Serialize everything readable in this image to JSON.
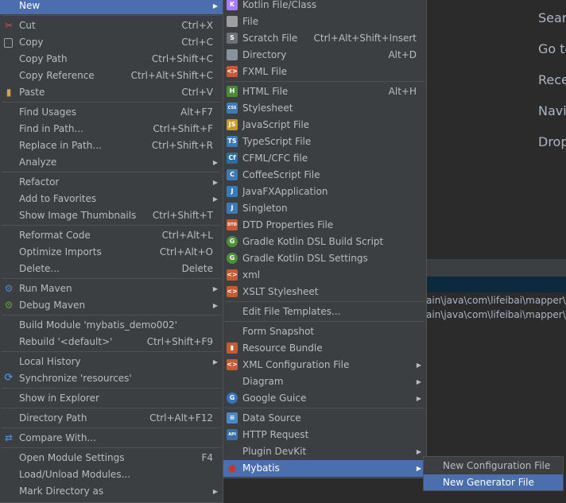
{
  "editor_hints": [
    "Searc",
    "Go to",
    "Rece",
    "Navi",
    "Drop"
  ],
  "console_lines": [
    "ain\\java\\com\\lifeibai\\mapper\\U",
    "ain\\java\\com\\lifeibai\\mapper\\C"
  ],
  "main_menu": [
    {
      "label": "New",
      "shortcut": "",
      "arrow": true,
      "sel": true,
      "icon": ""
    },
    {
      "label": "Cut",
      "shortcut": "Ctrl+X",
      "icon": "scissors-icon"
    },
    {
      "label": "Copy",
      "shortcut": "Ctrl+C",
      "icon": "copy-icon"
    },
    {
      "label": "Copy Path",
      "shortcut": "Ctrl+Shift+C"
    },
    {
      "label": "Copy Reference",
      "shortcut": "Ctrl+Alt+Shift+C"
    },
    {
      "label": "Paste",
      "shortcut": "Ctrl+V",
      "icon": "paste-icon"
    },
    {
      "label": "Find Usages",
      "shortcut": "Alt+F7"
    },
    {
      "label": "Find in Path...",
      "shortcut": "Ctrl+Shift+F"
    },
    {
      "label": "Replace in Path...",
      "shortcut": "Ctrl+Shift+R"
    },
    {
      "label": "Analyze",
      "shortcut": "",
      "arrow": true
    },
    {
      "label": "Refactor",
      "shortcut": "",
      "arrow": true
    },
    {
      "label": "Add to Favorites",
      "shortcut": "",
      "arrow": true
    },
    {
      "label": "Show Image Thumbnails",
      "shortcut": "Ctrl+Shift+T"
    },
    {
      "label": "Reformat Code",
      "shortcut": "Ctrl+Alt+L"
    },
    {
      "label": "Optimize Imports",
      "shortcut": "Ctrl+Alt+O"
    },
    {
      "label": "Delete...",
      "shortcut": "Delete"
    },
    {
      "label": "Run Maven",
      "shortcut": "",
      "arrow": true,
      "icon": "maven-run-icon"
    },
    {
      "label": "Debug Maven",
      "shortcut": "",
      "arrow": true,
      "icon": "maven-debug-icon"
    },
    {
      "label": "Build Module 'mybatis_demo002'",
      "shortcut": ""
    },
    {
      "label": "Rebuild '<default>'",
      "shortcut": "Ctrl+Shift+F9"
    },
    {
      "label": "Local History",
      "shortcut": "",
      "arrow": true
    },
    {
      "label": "Synchronize 'resources'",
      "shortcut": "",
      "icon": "sync-icon"
    },
    {
      "label": "Show in Explorer",
      "shortcut": ""
    },
    {
      "label": "Directory Path",
      "shortcut": "Ctrl+Alt+F12"
    },
    {
      "label": "Compare With...",
      "shortcut": "",
      "icon": "compare-icon"
    },
    {
      "label": "Open Module Settings",
      "shortcut": "F4"
    },
    {
      "label": "Load/Unload Modules...",
      "shortcut": ""
    },
    {
      "label": "Mark Directory as",
      "shortcut": "",
      "arrow": true
    }
  ],
  "new_menu": [
    {
      "label": "Kotlin File/Class",
      "shortcut": "",
      "icon": "kotlin-icon",
      "ictext": "K",
      "color": "#a97bff"
    },
    {
      "label": "File",
      "shortcut": "",
      "icon": "file-icon",
      "ictext": "",
      "color": "#9e9e9e"
    },
    {
      "label": "Scratch File",
      "shortcut": "Ctrl+Alt+Shift+Insert",
      "icon": "scratch-file-icon",
      "ictext": "S",
      "color": "#6e7378"
    },
    {
      "label": "Directory",
      "shortcut": "Alt+D",
      "icon": "folder-icon",
      "ictext": "",
      "color": "#87939a"
    },
    {
      "label": "FXML File",
      "shortcut": "",
      "icon": "fxml-icon",
      "ictext": "<>",
      "color": "#c55a34"
    },
    {
      "label": "HTML File",
      "shortcut": "Alt+H",
      "icon": "html-icon",
      "ictext": "H",
      "color": "#4a8a3a"
    },
    {
      "label": "Stylesheet",
      "shortcut": "",
      "icon": "css-icon",
      "ictext": "CSS",
      "color": "#3d7ab8"
    },
    {
      "label": "JavaScript File",
      "shortcut": "",
      "icon": "javascript-icon",
      "ictext": "JS",
      "color": "#c59a28"
    },
    {
      "label": "TypeScript File",
      "shortcut": "",
      "icon": "typescript-icon",
      "ictext": "TS",
      "color": "#3a7ab8"
    },
    {
      "label": "CFML/CFC file",
      "shortcut": "",
      "icon": "cfml-icon",
      "ictext": "Cf",
      "color": "#2c6fa6"
    },
    {
      "label": "CoffeeScript File",
      "shortcut": "",
      "icon": "coffeescript-icon",
      "ictext": "C",
      "color": "#3a7ab8"
    },
    {
      "label": "JavaFXApplication",
      "shortcut": "",
      "icon": "javafx-icon",
      "ictext": "J",
      "color": "#3a7ab8"
    },
    {
      "label": "Singleton",
      "shortcut": "",
      "icon": "singleton-icon",
      "ictext": "J",
      "color": "#3a7ab8"
    },
    {
      "label": "DTD Properties File",
      "shortcut": "",
      "icon": "dtd-icon",
      "ictext": "DTD",
      "color": "#c55a34"
    },
    {
      "label": "Gradle Kotlin DSL Build Script",
      "shortcut": "",
      "icon": "gradle-icon",
      "ictext": "G",
      "color": "#4f8f3a"
    },
    {
      "label": "Gradle Kotlin DSL Settings",
      "shortcut": "",
      "icon": "gradle-icon",
      "ictext": "G",
      "color": "#4f8f3a"
    },
    {
      "label": "xml",
      "shortcut": "",
      "icon": "xml-icon",
      "ictext": "<>",
      "color": "#c55a34"
    },
    {
      "label": "XSLT Stylesheet",
      "shortcut": "",
      "icon": "xslt-icon",
      "ictext": "<>",
      "color": "#c55a34"
    },
    {
      "label": "Edit File Templates...",
      "shortcut": ""
    },
    {
      "label": "Form Snapshot",
      "shortcut": ""
    },
    {
      "label": "Resource Bundle",
      "shortcut": "",
      "icon": "resource-bundle-icon",
      "ictext": "▮",
      "color": "#c55a34"
    },
    {
      "label": "XML Configuration File",
      "shortcut": "",
      "arrow": true,
      "icon": "xml-config-icon",
      "ictext": "<>",
      "color": "#c55a34"
    },
    {
      "label": "Diagram",
      "shortcut": "",
      "arrow": true
    },
    {
      "label": "Google Guice",
      "shortcut": "",
      "arrow": true,
      "icon": "google-icon",
      "ictext": "G",
      "color": "#3b73b9"
    },
    {
      "label": "Data Source",
      "shortcut": "",
      "icon": "database-icon",
      "ictext": "≡",
      "color": "#4a88c7"
    },
    {
      "label": "HTTP Request",
      "shortcut": "",
      "icon": "api-icon",
      "ictext": "API",
      "color": "#3a6ea5"
    },
    {
      "label": "Plugin DevKit",
      "shortcut": "",
      "arrow": true
    },
    {
      "label": "Mybatis",
      "shortcut": "",
      "arrow": true,
      "sel": true,
      "icon": "mybatis-icon",
      "ictext": "●",
      "color": "#c0392b"
    }
  ],
  "mybatis_menu": [
    {
      "label": "New Configuration File",
      "shortcut": ""
    },
    {
      "label": "New Generator File",
      "shortcut": "",
      "sel": true
    }
  ]
}
